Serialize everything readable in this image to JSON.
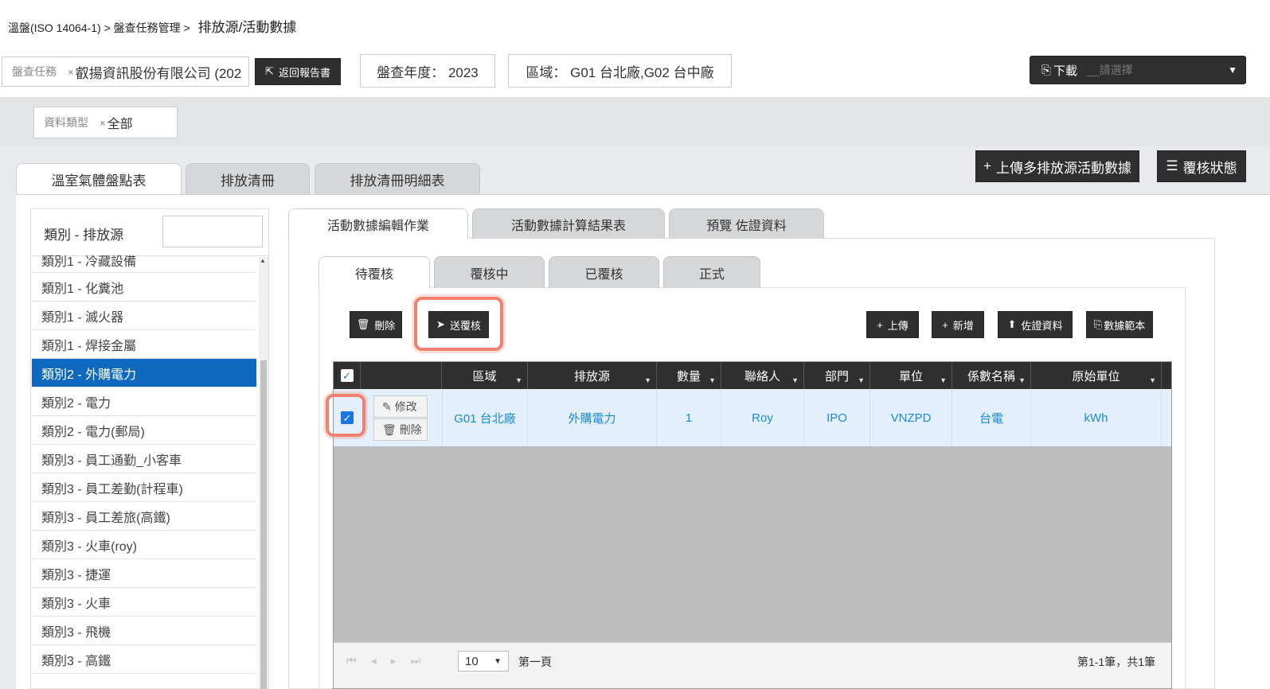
{
  "breadcrumb": {
    "part1": "溫盤(ISO 14064-1) > 盤查任務管理 >",
    "current": "排放源/活動數據"
  },
  "filters": {
    "task": {
      "label": "盤查任務",
      "value": "叡揚資訊股份有限公司 (202"
    },
    "back_button": "返回報告書",
    "year": "盤查年度： 2023",
    "region": "區域： G01 台北廠,G02 台中廠",
    "download": {
      "label": "下載",
      "placeholder": "__請選擇"
    },
    "data_type": {
      "label": "資料類型",
      "value": "全部"
    }
  },
  "actions": {
    "upload_multi": "上傳多排放源活動數據",
    "review_status": "覆核狀態"
  },
  "main_tabs": [
    "溫室氣體盤點表",
    "排放清冊",
    "排放清冊明細表"
  ],
  "sidebar": {
    "header": "類別 - 排放源",
    "search_value": "",
    "items": [
      "類別1 - 冷藏設備",
      "類別1 - 化糞池",
      "類別1 - 滅火器",
      "類別1 - 焊接金屬",
      "類別2 - 外購電力",
      "類別2 - 電力",
      "類別2 - 電力(郵局)",
      "類別3 - 員工通勤_小客車",
      "類別3 - 員工差勤(計程車)",
      "類別3 - 員工差旅(高鐵)",
      "類別3 - 火車(roy)",
      "類別3 - 捷運",
      "類別3 - 火車",
      "類別3 - 飛機",
      "類別3 - 高鐵"
    ],
    "selected_index": 4
  },
  "sub_tabs": [
    "活動數據編輯作業",
    "活動數據計算結果表",
    "預覽 佐證資料"
  ],
  "status_tabs": [
    "待覆核",
    "覆核中",
    "已覆核",
    "正式"
  ],
  "toolbar": {
    "delete": "刪除",
    "send_review": "送覆核",
    "upload": "上傳",
    "add": "新增",
    "evidence": "佐證資料",
    "template": "數據範本"
  },
  "table": {
    "columns": [
      "區域",
      "排放源",
      "數量",
      "聯絡人",
      "部門",
      "單位",
      "係數名稱",
      "原始單位"
    ],
    "rows": [
      {
        "cells": [
          "G01 台北廠",
          "外購電力",
          "1",
          "Roy",
          "IPO",
          "VNZPD",
          "台電",
          "kWh"
        ],
        "edit": "修改",
        "delete": "刪除",
        "checked": true
      }
    ]
  },
  "pager": {
    "page_size": "10",
    "page_label": "第一頁",
    "summary": "第1-1筆，共1筆"
  }
}
